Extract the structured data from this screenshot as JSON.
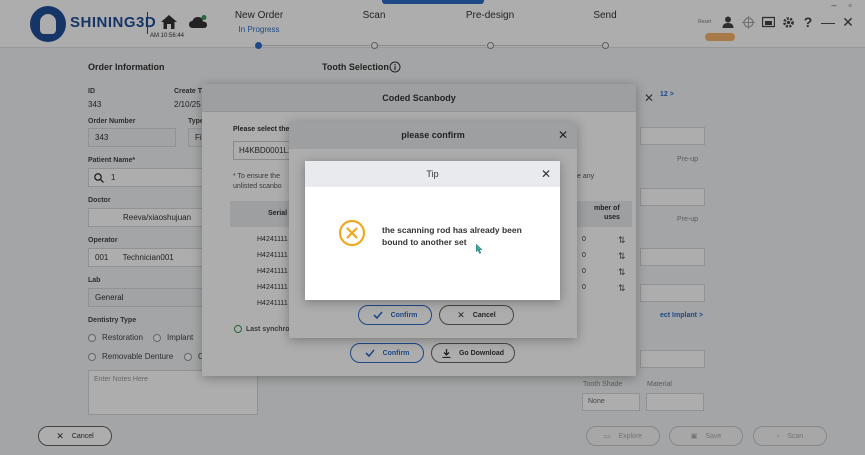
{
  "header": {
    "brand": "SHINING3D",
    "time": "AM 10:56:44",
    "steps": [
      {
        "title": "New Order",
        "status": "In Progress"
      },
      {
        "title": "Scan",
        "status": ""
      },
      {
        "title": "Pre-design",
        "status": ""
      },
      {
        "title": "Send",
        "status": ""
      }
    ],
    "reset_label": "Reset"
  },
  "order": {
    "section_title": "Order Information",
    "id_label": "ID",
    "id_value": "343",
    "create_label": "Create T",
    "create_value": "2/10/25",
    "order_number_label": "Order Number",
    "order_number_value": "343",
    "type_label": "Type",
    "type_value": "Fi",
    "patient_label": "Patient Name*",
    "patient_value": "1",
    "doctor_label": "Doctor",
    "doctor_value": "Reeva/xiaoshujuan",
    "operator_label": "Operator",
    "operator_id": "001",
    "operator_value": "Technician001",
    "lab_label": "Lab",
    "lab_value": "General",
    "dentistry_label": "Dentistry Type",
    "restoration": "Restoration",
    "implant": "Implant",
    "removable": "Removable Denture",
    "other": "O",
    "notes_placeholder": "Enter Notes Here"
  },
  "tooth": {
    "section_title": "Tooth Selection",
    "link_top": "12 >",
    "link_implant": "ect Implant >",
    "tooth_shade_label": "Tooth Shade",
    "material_label": "Material",
    "tooth_shade_value": "None",
    "side_pre_up": "Pre-up"
  },
  "footer": {
    "cancel": "Cancel",
    "explore": "Explore",
    "save": "Save",
    "scan": "Scan"
  },
  "scanbody_dialog": {
    "title": "Coded Scanbody",
    "select_label": "Please select the",
    "input_value": "H4KBD0001L1",
    "note_line1": "* To ensure the",
    "note_line2": "unlisted scanbo",
    "note_right": "e any",
    "col_serial": "Serial",
    "col_uses_line1": "mber of",
    "col_uses_line2": "uses",
    "rows": [
      {
        "serial": "H4241111",
        "uses": "0"
      },
      {
        "serial": "H4241111",
        "uses": "0"
      },
      {
        "serial": "H4241111",
        "uses": "0"
      },
      {
        "serial": "H4241111",
        "uses": "0"
      },
      {
        "serial": "H4241111",
        "uses": ""
      }
    ],
    "last_sync": "Last synchron",
    "confirm": "Confirm",
    "download": "Go Download"
  },
  "confirm_dialog": {
    "title": "please confirm",
    "confirm": "Confirm",
    "cancel": "Cancel"
  },
  "tip_dialog": {
    "title": "Tip",
    "message_line1": "the scanning rod has already been",
    "message_line2": "bound to another set"
  },
  "colors": {
    "brand_blue": "#1f4f99",
    "accent_blue": "#2d6cc9",
    "warning_orange": "#f0a81e"
  }
}
